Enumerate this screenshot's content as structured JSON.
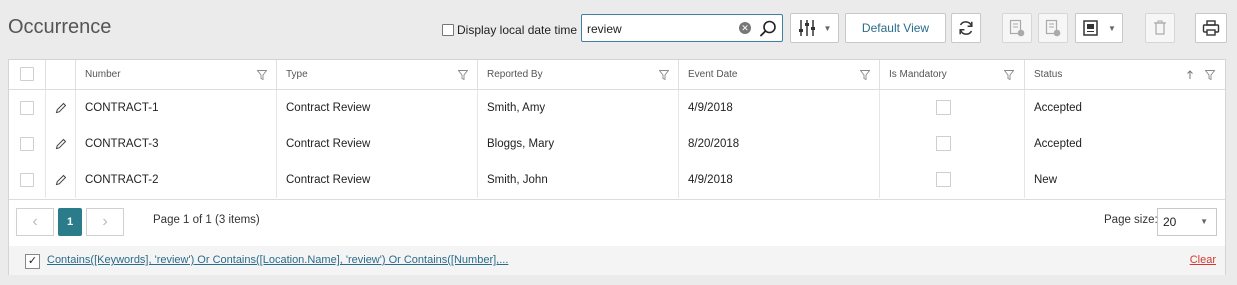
{
  "page": {
    "title": "Occurrence"
  },
  "toolbar": {
    "local_dt_label": "Display local date time",
    "search_value": "review",
    "default_view_label": "Default View"
  },
  "columns": [
    {
      "label": "Number"
    },
    {
      "label": "Type"
    },
    {
      "label": "Reported By"
    },
    {
      "label": "Event Date"
    },
    {
      "label": "Is Mandatory"
    },
    {
      "label": "Status"
    }
  ],
  "rows": [
    {
      "number": "CONTRACT-1",
      "type": "Contract Review",
      "reported_by": "Smith, Amy",
      "event_date": "4/9/2018",
      "status": "Accepted"
    },
    {
      "number": "CONTRACT-3",
      "type": "Contract Review",
      "reported_by": "Bloggs, Mary",
      "event_date": "8/20/2018",
      "status": "Accepted"
    },
    {
      "number": "CONTRACT-2",
      "type": "Contract Review",
      "reported_by": "Smith, John",
      "event_date": "4/9/2018",
      "status": "New"
    }
  ],
  "pager": {
    "current_page": "1",
    "info": "Page 1 of 1 (3 items)",
    "page_size_label": "Page size:",
    "page_size": "20"
  },
  "filter": {
    "expression": "Contains([Keywords], 'review') Or Contains([Location.Name], 'review') Or Contains([Number],...",
    "clear_label": "Clear",
    "check_mark": "✓"
  },
  "icons": {
    "search": "search-icon",
    "clear": "clear-search-icon",
    "column_chooser": "column-settings-icon",
    "refresh": "refresh-icon",
    "edit": "pencil-icon",
    "filter": "filter-icon",
    "sort_asc": "sort-ascending-icon",
    "print": "printer-icon",
    "delete": "trash-icon"
  },
  "colors": {
    "accent": "#2a7c8a",
    "link": "#2a6c8c",
    "clear": "#d23a2f"
  }
}
